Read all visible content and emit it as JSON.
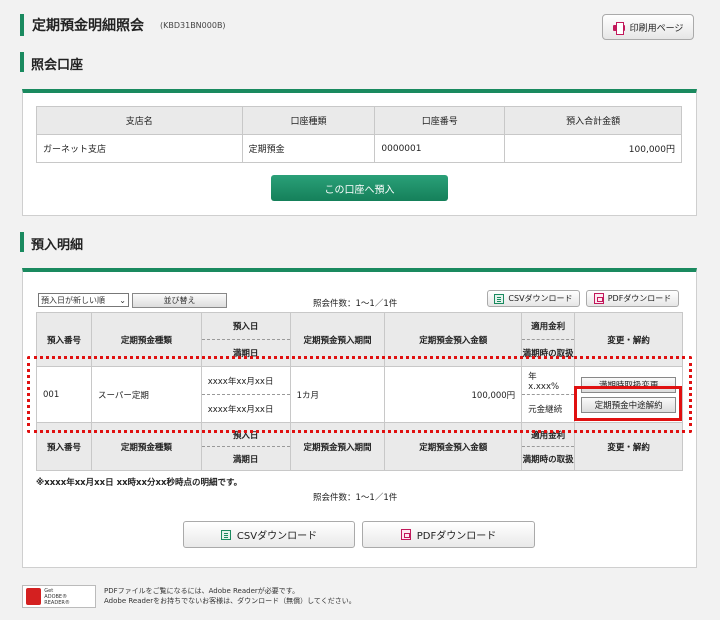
{
  "header": {
    "title": "定期預金明細照会",
    "code": "(KBD31BN000B)",
    "print_label": "印刷用ページ"
  },
  "account_section": {
    "title": "照会口座",
    "columns": [
      "支店名",
      "口座種類",
      "口座番号",
      "預入合計金額"
    ],
    "row": {
      "branch": "ガーネット支店",
      "type": "定期預金",
      "number": "0000001",
      "total": "100,000円"
    },
    "deposit_button": "この口座へ預入"
  },
  "deposit_section": {
    "title": "預入明細",
    "sort_option": "預入日が新しい順",
    "sort_button": "並び替え",
    "count_text": "照会件数：1～1／1件",
    "csv_label": "CSVダウンロード",
    "pdf_label": "PDFダウンロード",
    "columns": {
      "no": "預入番号",
      "kind": "定期預金種類",
      "deposit_date": "預入日",
      "maturity_date": "満期日",
      "period": "定期預金預入期間",
      "amount": "定期預金預入金額",
      "rate": "適用金利",
      "maturity_handling": "満期時の取扱",
      "actions": "変更・解約"
    },
    "row": {
      "no": "001",
      "kind": "スーパー定期",
      "deposit_date": "xxxx年xx月xx日",
      "maturity_date": "xxxx年xx月xx日",
      "period": "1カ月",
      "amount": "100,000円",
      "rate": "年 x.xxx%",
      "handling": "元金継続",
      "change_button": "満期時取扱変更",
      "cancel_button": "定期預金中途解約"
    },
    "note": "※xxxx年xx月xx日 xx時xx分xx秒時点の明細です。"
  },
  "footer": {
    "reader_badge": [
      "Get",
      "ADOBE® READER®"
    ],
    "note_line1": "PDFファイルをご覧になるには、Adobe Readerが必要です。",
    "note_line2": "Adobe Readerをお持ちでないお客様は、ダウンロード（無償）してください。"
  },
  "colors": {
    "accent_green": "#1a8a5f",
    "highlight_red": "#e01010",
    "pdf_icon": "#c2185b"
  }
}
